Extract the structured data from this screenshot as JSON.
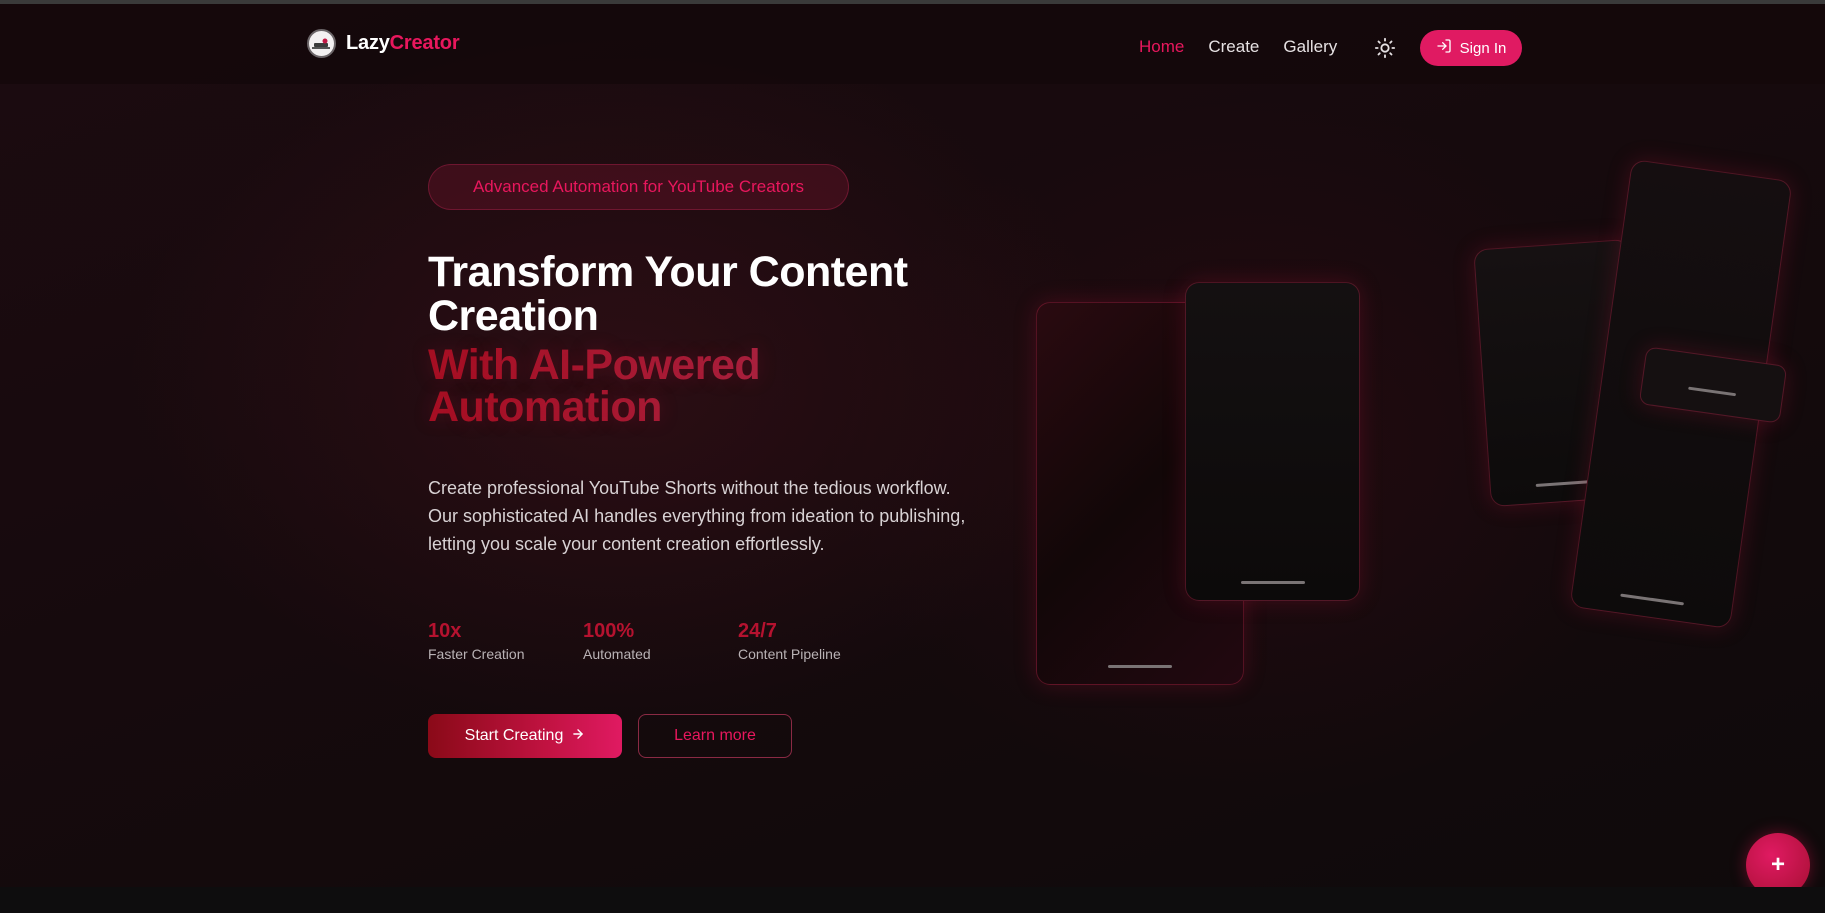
{
  "brand": {
    "name_part1": "Lazy",
    "name_part2": "Creator",
    "accent": "#e8175d",
    "logo_icon": "avatar-logo"
  },
  "nav": {
    "links": [
      {
        "label": "Home",
        "active": true
      },
      {
        "label": "Create",
        "active": false
      },
      {
        "label": "Gallery",
        "active": false
      }
    ],
    "theme_toggle_icon": "sun-icon",
    "signin_label": "Sign In",
    "signin_icon": "sign-in-icon"
  },
  "hero": {
    "badge": "Advanced Automation for YouTube Creators",
    "title_line": "Transform Your Content Creation",
    "title_gradient": "With AI-Powered Automation",
    "description": "Create professional YouTube Shorts without the tedious workflow. Our sophisticated AI handles everything from ideation to publishing, letting you scale your content creation effortlessly.",
    "stats": [
      {
        "value": "10x",
        "label": "Faster Creation"
      },
      {
        "value": "100%",
        "label": "Automated"
      },
      {
        "value": "24/7",
        "label": "Content Pipeline"
      }
    ],
    "primary_cta": "Start Creating",
    "primary_cta_icon": "arrow-right-icon",
    "secondary_cta": "Learn more"
  },
  "fab": {
    "label": "+",
    "icon": "plus-icon"
  },
  "colors": {
    "background": "#120a0c",
    "accent": "#e01a62",
    "gradient_text": "#a50f22"
  }
}
